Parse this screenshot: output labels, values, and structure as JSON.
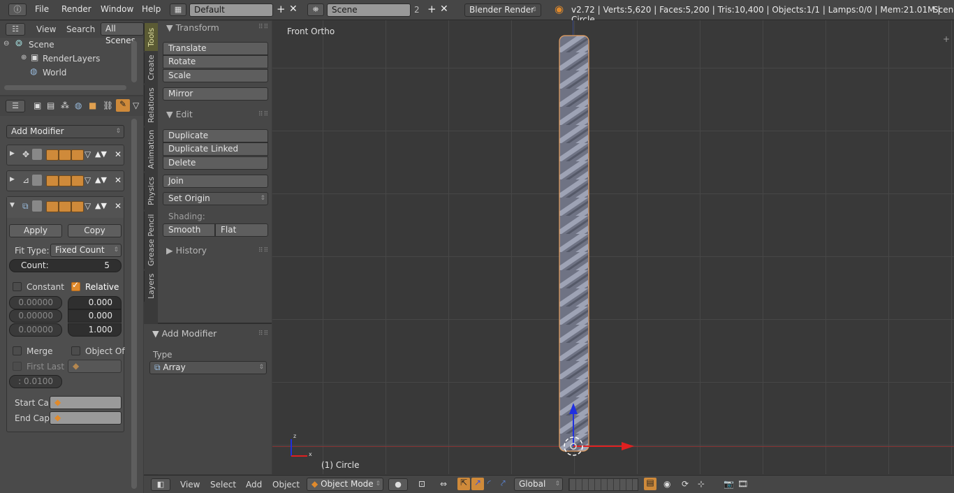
{
  "topbar": {
    "menus": [
      "File",
      "Render",
      "Window",
      "Help"
    ],
    "layout": "Default",
    "scene": "Scene",
    "scene_users": "2",
    "engine": "Blender Render",
    "stats": "v2.72 | Verts:5,620 | Faces:5,200 | Tris:10,400 | Objects:1/1 | Lamps:0/0 | Mem:21.01M | Circle",
    "right_label": "Scene"
  },
  "outliner": {
    "menus": [
      "View",
      "Search",
      "All Scenes"
    ],
    "items": [
      "Scene",
      "RenderLayers",
      "World"
    ]
  },
  "properties": {
    "add_modifier": "Add Modifier",
    "apply": "Apply",
    "copy": "Copy",
    "fit_type_label": "Fit Type:",
    "fit_type_value": "Fixed Count",
    "count_label": "Count:",
    "count_value": "5",
    "constant": "Constant",
    "relative": "Relative",
    "const_offsets": [
      "0.00000",
      "0.00000",
      "0.00000"
    ],
    "rel_offsets": [
      "0.000",
      "0.000",
      "1.000"
    ],
    "merge": "Merge",
    "object_offset": "Object Of",
    "first_last": "First Last",
    "merge_distance": ": 0.0100",
    "start_cap": "Start Ca",
    "end_cap": "End Cap:"
  },
  "vtabs": [
    "Tools",
    "Create",
    "Relations",
    "Animation",
    "Physics",
    "Grease Pencil",
    "Layers"
  ],
  "tools": {
    "transform": "Transform",
    "translate": "Translate",
    "rotate": "Rotate",
    "scale": "Scale",
    "mirror": "Mirror",
    "edit": "Edit",
    "duplicate": "Duplicate",
    "duplicate_linked": "Duplicate Linked",
    "delete": "Delete",
    "join": "Join",
    "set_origin": "Set Origin",
    "shading": "Shading:",
    "smooth": "Smooth",
    "flat": "Flat",
    "history": "History"
  },
  "operator": {
    "title": "Add Modifier",
    "type_label": "Type",
    "type_value": "Array"
  },
  "viewport": {
    "view_label": "Front Ortho",
    "object_label": "(1) Circle"
  },
  "bottombar": {
    "menus": [
      "View",
      "Select",
      "Add",
      "Object"
    ],
    "mode": "Object Mode",
    "orientation": "Global"
  },
  "colors": {
    "accent": "#e08a2c",
    "x_axis": "#e02020",
    "z_axis": "#2030e0"
  }
}
